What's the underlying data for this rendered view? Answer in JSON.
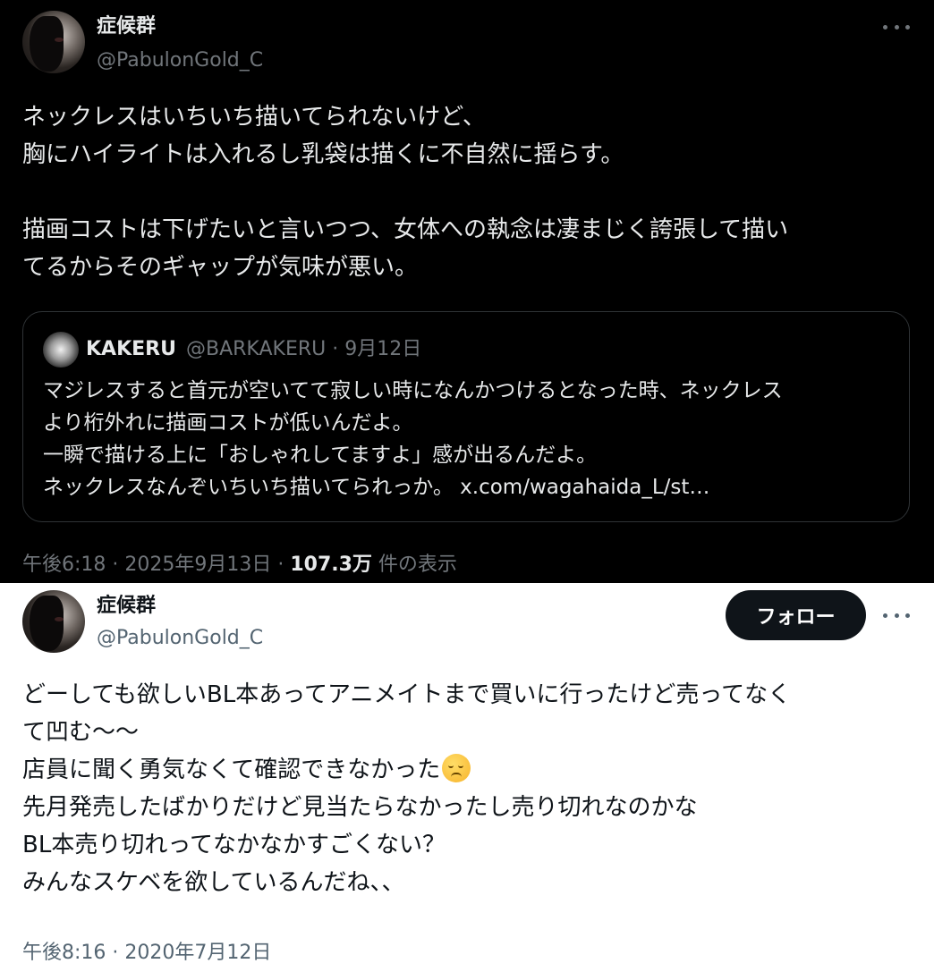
{
  "tweet1": {
    "display_name": "症候群",
    "handle": "@PabulonGold_C",
    "text": "ネックレスはいちいち描いてられないけど、\n胸にハイライトは入れるし乳袋は描くに不自然に揺らす。\n\n描画コストは下げたいと言いつつ、女体への執念は凄まじく誇張して描い\nてるからそのギャップが気味が悪い。",
    "quote": {
      "display_name": "KAKERU",
      "meta": "@BARKAKERU · 9月12日",
      "text": "マジレスすると首元が空いてて寂しい時になんかつけるとなった時、ネックレス\nより桁外れに描画コストが低いんだよ。\n一瞬で描ける上に「おしゃれしてますよ」感が出るんだよ。\nネックレスなんぞいちいち描いてられっか。",
      "link": "x.com/wagahaida_L/st…"
    },
    "timestamp": "午後6:18 · 2025年9月13日 · ",
    "views": "107.3万",
    "views_suffix": " 件の表示"
  },
  "tweet2": {
    "display_name": "症候群",
    "handle": "@PabulonGold_C",
    "follow_label": "フォロー",
    "text_part1": "どーしても欲しいBL本あってアニメイトまで買いに行ったけど売ってなく\nて凹む〜〜\n店員に聞く勇気なくて確認できなかった",
    "emoji": "disappointed-face",
    "text_part2": "先月発売したばかりだけど見当たらなかったし売り切れなのかな\nBL本売り切れってなかなかすごくない？\nみんなスケベを欲しているんだね、、",
    "timestamp": "午後8:16 · 2020年7月12日"
  },
  "colors": {
    "dark_bg": "#000000",
    "light_bg": "#ffffff",
    "dark_text": "#e7e9ea",
    "muted_dark": "#71767b",
    "muted_light": "#536471",
    "follow_bg": "#0f1419"
  }
}
